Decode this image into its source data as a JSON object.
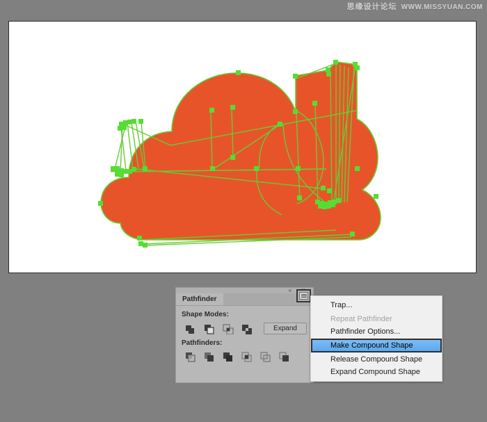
{
  "watermark": {
    "chinese": "思缘设计论坛",
    "url": "WWW.MISSYUAN.COM"
  },
  "artboard": {
    "name": "illustrator-artboard",
    "background_color": "#FFFFFF",
    "shape_fill": "#E8542A",
    "path_stroke": "#66CC33",
    "anchor_color": "#55DD33",
    "description": "Orange cloud shape with selected vector paths and green anchor points"
  },
  "panel": {
    "tab_label": "Pathfinder",
    "collapse_icons": "« ˅",
    "menu_button_icon": "hamburger-menu-icon",
    "shape_modes_label": "Shape Modes:",
    "pathfinders_label": "Pathfinders:",
    "expand_label": "Expand",
    "shape_mode_buttons": [
      {
        "name": "unite",
        "icon": "unite-icon"
      },
      {
        "name": "minus-front",
        "icon": "minus-front-icon"
      },
      {
        "name": "intersect",
        "icon": "intersect-icon"
      },
      {
        "name": "exclude",
        "icon": "exclude-icon"
      }
    ],
    "pathfinder_buttons": [
      {
        "name": "divide",
        "icon": "divide-icon"
      },
      {
        "name": "trim",
        "icon": "trim-icon"
      },
      {
        "name": "merge",
        "icon": "merge-icon"
      },
      {
        "name": "crop",
        "icon": "crop-icon"
      },
      {
        "name": "outline",
        "icon": "outline-icon"
      },
      {
        "name": "minus-back",
        "icon": "minus-back-icon"
      }
    ]
  },
  "menu": {
    "items": [
      {
        "label": "Trap...",
        "state": "normal"
      },
      {
        "label": "Repeat Pathfinder",
        "state": "disabled"
      },
      {
        "label": "Pathfinder Options...",
        "state": "normal"
      },
      {
        "label": "Make Compound Shape",
        "state": "selected"
      },
      {
        "label": "Release Compound Shape",
        "state": "normal"
      },
      {
        "label": "Expand Compound Shape",
        "state": "normal"
      }
    ],
    "highlight_color": "#6DB3F2"
  }
}
